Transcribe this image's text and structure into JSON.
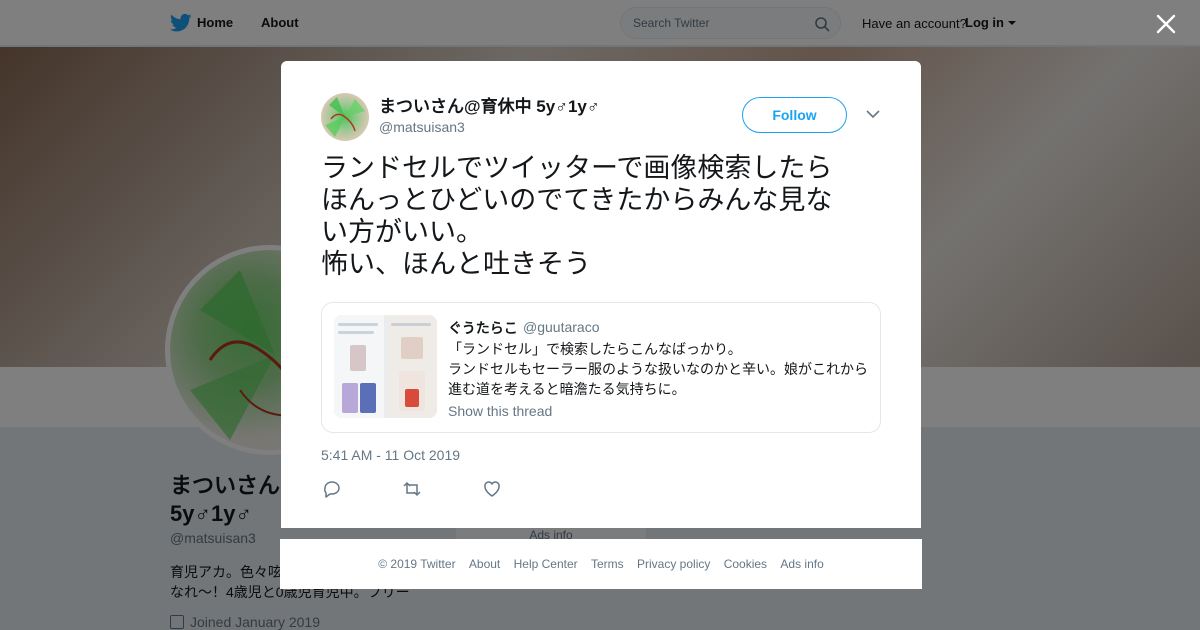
{
  "nav": {
    "home": "Home",
    "about": "About",
    "search_placeholder": "Search Twitter",
    "have_account": "Have an account?",
    "login": "Log in"
  },
  "profile": {
    "name_line1": "まついさん",
    "name_line2": "5y♂1y♂",
    "handle": "@matsuisan3",
    "bio_line1": "育児アカ。色々呟",
    "bio_line2": "なれ〜！4歳児と0歳児育児中。フリー",
    "joined": "Joined January 2019",
    "ads_info_peek": "Ads info"
  },
  "tweet": {
    "author_name": "まついさん@育休中 5y♂1y♂",
    "author_handle": "@matsuisan3",
    "follow_label": "Follow",
    "text_lines": [
      "ランドセルでツイッターで画像検索したら",
      "ほんっとひどいのでてきたからみんな見な",
      "い方がいい。",
      "怖い、ほんと吐きそう"
    ],
    "timestamp": "5:41 AM - 11 Oct 2019"
  },
  "quote": {
    "author_name": "ぐうたらこ",
    "author_handle": "@guutaraco",
    "lines": [
      "「ランドセル」で検索したらこんなばっかり。",
      "ランドセルもセーラー服のような扱いなのかと辛い。娘がこれから",
      "進む道を考えると暗澹たる気持ちに。"
    ],
    "show_thread": "Show this thread"
  },
  "footer": {
    "links": [
      "© 2019 Twitter",
      "About",
      "Help Center",
      "Terms",
      "Privacy policy",
      "Cookies",
      "Ads info"
    ]
  },
  "colors": {
    "accent": "#1da1f2",
    "secondary_text": "#657786",
    "overlay": "rgba(0,0,0,0.5)"
  },
  "icons": [
    "twitter-bird-icon",
    "search-icon",
    "caret-down-icon",
    "close-icon",
    "chevron-down-icon",
    "reply-icon",
    "retweet-icon",
    "like-icon",
    "calendar-icon"
  ]
}
